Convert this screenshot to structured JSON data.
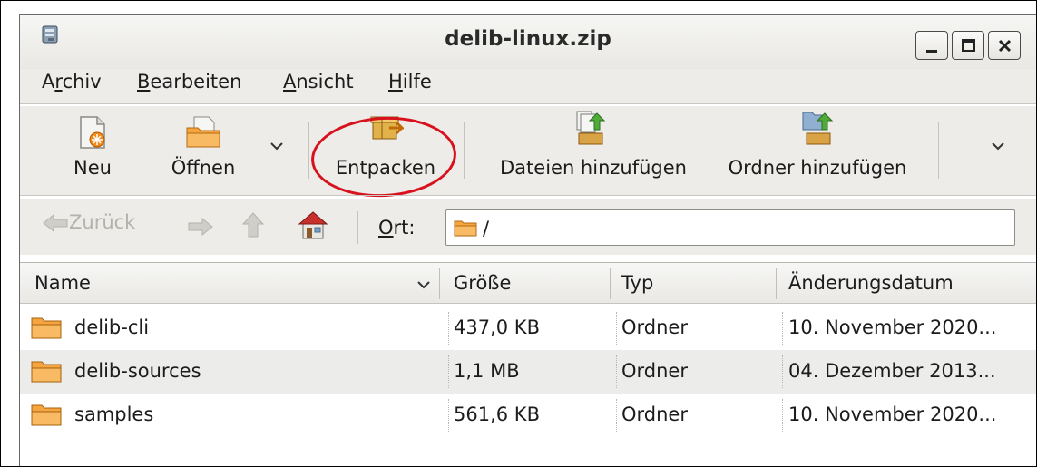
{
  "window": {
    "title": "delib-linux.zip",
    "controls": [
      "minimize",
      "maximize",
      "close"
    ]
  },
  "menubar": {
    "items": [
      {
        "label_pre": "A",
        "label_u": "r",
        "label_post": "chiv"
      },
      {
        "label_pre": "",
        "label_u": "B",
        "label_post": "earbeiten"
      },
      {
        "label_pre": "",
        "label_u": "A",
        "label_post": "nsicht"
      },
      {
        "label_pre": "",
        "label_u": "H",
        "label_post": "ilfe"
      }
    ]
  },
  "toolbar": {
    "new_label": "Neu",
    "open_label": "Öffnen",
    "extract_label": "Entpacken",
    "add_files_label": "Dateien hinzufügen",
    "add_folder_label": "Ordner hinzufügen",
    "highlight_color": "#d8121d"
  },
  "location": {
    "back_label": "Zurück",
    "location_label_u": "O",
    "location_label_post": "rt:",
    "path": "/"
  },
  "table": {
    "columns": [
      "Name",
      "Größe",
      "Typ",
      "Änderungsdatum"
    ],
    "rows": [
      {
        "name": "delib-cli",
        "size": "437,0 KB",
        "type": "Ordner",
        "date": "10. November 2020..."
      },
      {
        "name": "delib-sources",
        "size": "1,1 MB",
        "type": "Ordner",
        "date": "04. Dezember 2013..."
      },
      {
        "name": "samples",
        "size": "561,6 KB",
        "type": "Ordner",
        "date": "10. November 2020..."
      }
    ]
  },
  "colors": {
    "folder": "#f0a040",
    "window_bg": "#edece9"
  }
}
